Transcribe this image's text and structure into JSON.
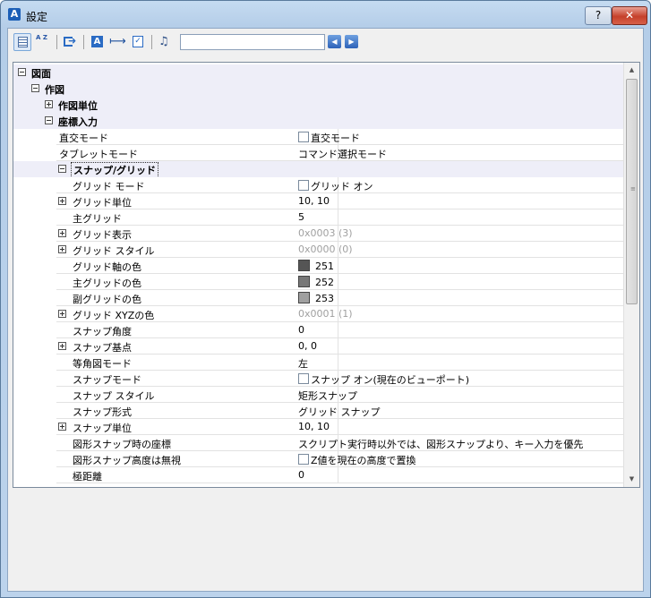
{
  "window": {
    "title": "設定",
    "help_label": "?",
    "close_label": "✕"
  },
  "toolbar": {
    "search_value": "",
    "az_label": "A Z",
    "app_label": "A",
    "dim_label": "⟼",
    "check_label": "✓",
    "binoc_label": "♫",
    "prev_label": "◀",
    "next_label": "▶"
  },
  "tree": {
    "drawing": "図面",
    "drafting": "作図",
    "units": "作図単位",
    "coord_input": "座標入力",
    "snap_grid": "スナップ/グリッド"
  },
  "properties": [
    {
      "name": "直交モード",
      "value": "直交モード",
      "checkbox": true
    },
    {
      "name": "タブレットモード",
      "value": "コマンド選択モード"
    }
  ],
  "snap_props": [
    {
      "name": "グリッド モード",
      "value": "グリッド オン",
      "checkbox": true
    },
    {
      "name": "グリッド単位",
      "value": "10, 10",
      "expand": true
    },
    {
      "name": "主グリッド",
      "value": "5"
    },
    {
      "name": "グリッド表示",
      "value": "0x0003 (3)",
      "expand": true,
      "gray": true
    },
    {
      "name": "グリッド スタイル",
      "value": "0x0000 (0)",
      "expand": true,
      "gray": true
    },
    {
      "name": "グリッド軸の色",
      "value": "251",
      "swatch": "#555555"
    },
    {
      "name": "主グリッドの色",
      "value": "252",
      "swatch": "#777777"
    },
    {
      "name": "副グリッドの色",
      "value": "253",
      "swatch": "#a0a0a0"
    },
    {
      "name": "グリッド XYZの色",
      "value": "0x0001 (1)",
      "expand": true,
      "gray": true
    },
    {
      "name": "スナップ角度",
      "value": "0"
    },
    {
      "name": "スナップ基点",
      "value": "0, 0",
      "expand": true
    },
    {
      "name": "等角図モード",
      "value": "左"
    },
    {
      "name": "スナップモード",
      "value": "スナップ オン(現在のビューポート)",
      "checkbox": true
    },
    {
      "name": "スナップ スタイル",
      "value": "矩形スナップ"
    },
    {
      "name": "スナップ形式",
      "value": "グリッド スナップ"
    },
    {
      "name": "スナップ単位",
      "value": "10, 10",
      "expand": true
    },
    {
      "name": "図形スナップ時の座標",
      "value": "スクリプト実行時以外では、図形スナップより、キー入力を優先"
    },
    {
      "name": "図形スナップ高度は無視",
      "value": "Z値を現在の高度で置換",
      "checkbox": true
    },
    {
      "name": "極距離",
      "value": "0"
    }
  ],
  "scrollbar": {
    "up": "▲",
    "down": "▼",
    "grip": "≡"
  }
}
